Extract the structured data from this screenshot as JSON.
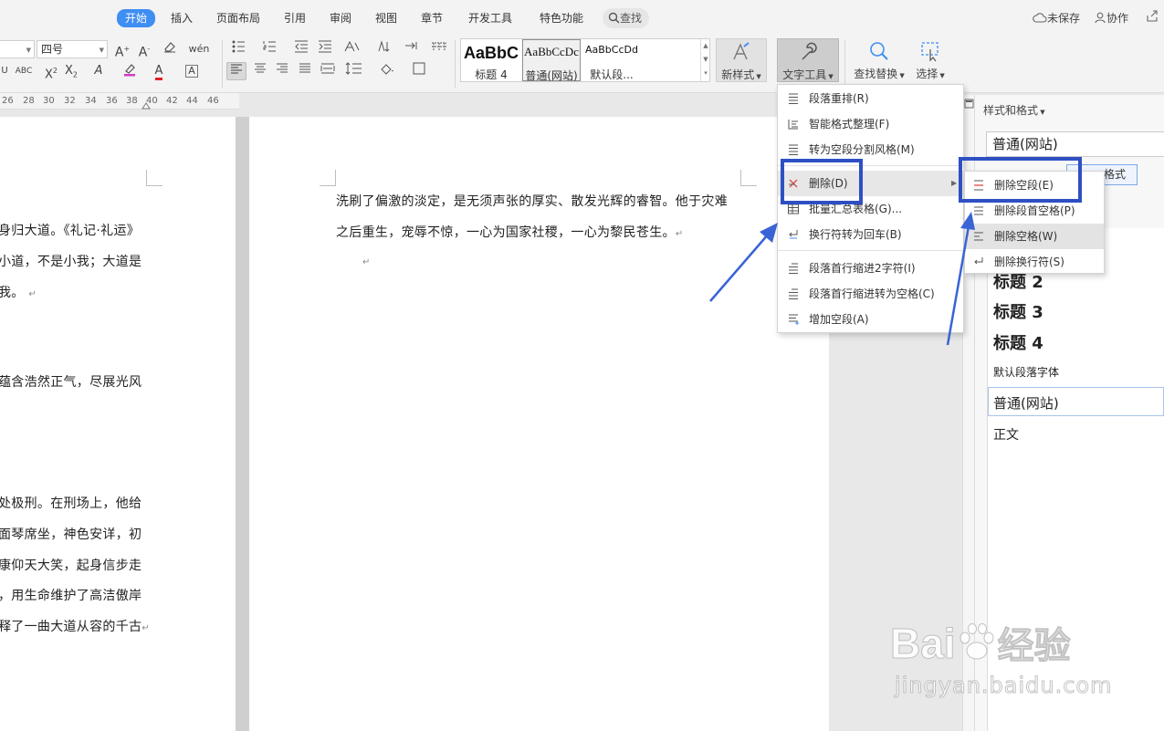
{
  "tabs": [
    "开始",
    "插入",
    "页面布局",
    "引用",
    "审阅",
    "视图",
    "章节",
    "开发工具",
    "特色功能"
  ],
  "search_tab": "查找",
  "top_right": {
    "unsaved": "未保存",
    "collab": "协作"
  },
  "ribbon": {
    "font_name": "",
    "font_size": "四号",
    "gallery": [
      {
        "sample": "AaBbC",
        "name": "标题 4"
      },
      {
        "sample": "AaBbCcDc",
        "name": "普通(网站)"
      },
      {
        "sample": "AaBbCcDd",
        "name": "默认段..."
      }
    ],
    "new_style": "新样式",
    "text_tools": "文字工具",
    "find_replace": "查找替换",
    "select": "选择"
  },
  "ruler_marks": [
    "26",
    "28",
    "30",
    "32",
    "34",
    "36",
    "38",
    "40",
    "42",
    "44",
    "46"
  ],
  "left_page_lines": [
    "身归大道。《礼记·礼运》",
    "小道，不是小我；大道是",
    "我。",
    "蕴含浩然正气，尽展光风",
    "处极刑。在刑场上，他给",
    "面琴席坐，神色安详，初",
    "康仰天大笑，起身信步走",
    "，用生命维护了高洁傲岸",
    "释了一曲大道从容的千古"
  ],
  "main_page_lines": [
    "洗刷了偏激的淡定，是无须声张的厚实、散发光辉的睿智。他于灾难",
    "之后重生，宠辱不惊，一心为国家社稷，一心为黎民苍生。"
  ],
  "text_tools_menu": [
    {
      "label": "段落重排(R)",
      "icon": "paragraph-icon"
    },
    {
      "label": "智能格式整理(F)",
      "icon": "format-icon"
    },
    {
      "label": "转为空段分割风格(M)",
      "icon": "split-icon"
    },
    {
      "label": "删除(D)",
      "icon": "delete-icon",
      "highlighted": true,
      "has_submenu": true
    },
    {
      "label": "批量汇总表格(G)...",
      "icon": "table-icon"
    },
    {
      "label": "换行符转为回车(B)",
      "icon": "linebreak-icon"
    },
    {
      "label": "段落首行缩进2字符(I)",
      "icon": "indent-icon"
    },
    {
      "label": "段落首行缩进转为空格(C)",
      "icon": "indent-space-icon"
    },
    {
      "label": "增加空段(A)",
      "icon": "add-paragraph-icon"
    }
  ],
  "delete_submenu": [
    {
      "label": "删除空段(E)",
      "icon": "delete-empty-paragraph-icon",
      "boxed": true
    },
    {
      "label": "删除段首空格(P)",
      "icon": "delete-leading-space-icon"
    },
    {
      "label": "删除空格(W)",
      "icon": "delete-space-icon",
      "highlighted": true
    },
    {
      "label": "删除换行符(S)",
      "icon": "delete-linebreak-icon"
    }
  ],
  "styles_pane": {
    "title": "样式和格式",
    "current": "普通(网站)",
    "clear_btn_partial": "格式",
    "list": [
      {
        "label": "标题 2",
        "weight": "bold",
        "size": 18
      },
      {
        "label": "标题 3",
        "weight": "bold",
        "size": 18
      },
      {
        "label": "标题 4",
        "weight": "bold",
        "size": 18
      },
      {
        "label": "默认段落字体",
        "weight": "normal",
        "size": 12
      },
      {
        "label": "普通(网站)",
        "weight": "normal",
        "size": 15,
        "boxed": true
      },
      {
        "label": "正文",
        "weight": "normal",
        "size": 14
      }
    ]
  },
  "watermark": {
    "brand": "Bai",
    "brand_cn": "经验",
    "url": "jingyan.baidu.com"
  },
  "colors": {
    "accent": "#3f8ef2",
    "callout": "#2e4fc4",
    "arrow": "#3a63d6"
  }
}
